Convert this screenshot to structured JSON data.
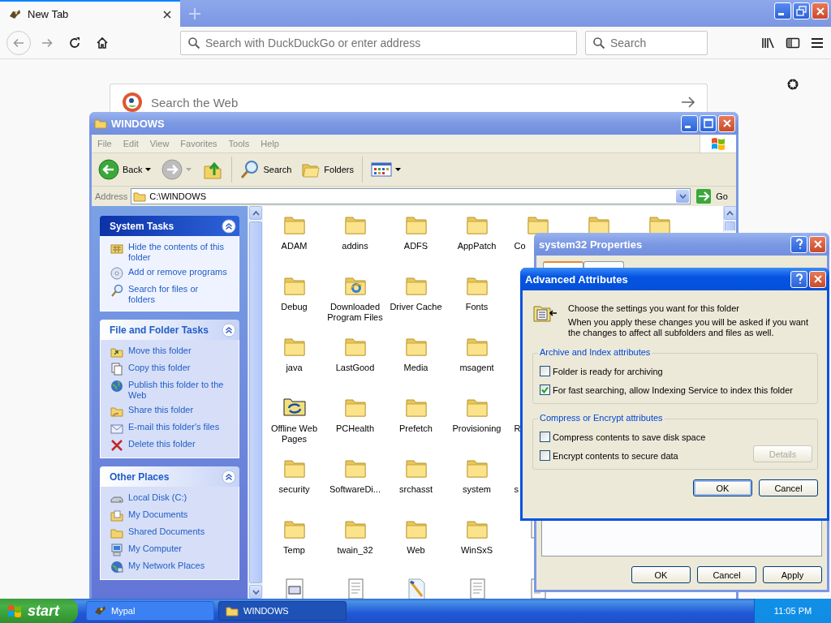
{
  "browser": {
    "tab": {
      "title": "New Tab"
    },
    "address_placeholder": "Search with DuckDuckGo or enter address",
    "search_placeholder": "Search",
    "page_search_placeholder": "Search the Web"
  },
  "explorer": {
    "title": "WINDOWS",
    "menu": [
      "File",
      "Edit",
      "View",
      "Favorites",
      "Tools",
      "Help"
    ],
    "toolbar": {
      "back": "Back",
      "search": "Search",
      "folders": "Folders"
    },
    "address_label": "Address",
    "address": "C:\\WINDOWS",
    "go": "Go",
    "panels": [
      {
        "title": "System Tasks",
        "kind": "primary",
        "items": [
          {
            "label": "Hide the contents of this folder",
            "kind": "hide"
          },
          {
            "label": "Add or remove programs",
            "kind": "programs"
          },
          {
            "label": "Search for files or folders",
            "kind": "search"
          }
        ]
      },
      {
        "title": "File and Folder Tasks",
        "kind": "normal",
        "items": [
          {
            "label": "Move this folder",
            "kind": "move"
          },
          {
            "label": "Copy this folder",
            "kind": "copy"
          },
          {
            "label": "Publish this folder to the Web",
            "kind": "publish"
          },
          {
            "label": "Share this folder",
            "kind": "share"
          },
          {
            "label": "E-mail this folder's files",
            "kind": "email"
          },
          {
            "label": "Delete this folder",
            "kind": "delete"
          }
        ]
      },
      {
        "title": "Other Places",
        "kind": "normal",
        "items": [
          {
            "label": "Local Disk (C:)",
            "kind": "disk"
          },
          {
            "label": "My Documents",
            "kind": "documents"
          },
          {
            "label": "Shared Documents",
            "kind": "shared"
          },
          {
            "label": "My Computer",
            "kind": "computer"
          },
          {
            "label": "My Network Places",
            "kind": "network"
          }
        ]
      }
    ],
    "file_rows": [
      [
        {
          "label": "ADAM",
          "kind": "folder"
        },
        {
          "label": "addins",
          "kind": "folder"
        },
        {
          "label": "ADFS",
          "kind": "folder"
        },
        {
          "label": "AppPatch",
          "kind": "folder"
        },
        {
          "label": "Co",
          "kind": "folder"
        },
        {
          "kind": "folder"
        },
        {
          "kind": "folder"
        }
      ],
      [
        {
          "label": "Debug",
          "kind": "folder"
        },
        {
          "label": "Downloaded Program Files",
          "kind": "web"
        },
        {
          "label": "Driver Cache",
          "kind": "folder"
        },
        {
          "label": "Fonts",
          "kind": "folder"
        }
      ],
      [
        {
          "label": "java",
          "kind": "folder"
        },
        {
          "label": "LastGood",
          "kind": "folder"
        },
        {
          "label": "Media",
          "kind": "folder"
        },
        {
          "label": "msagent",
          "kind": "folder"
        }
      ],
      [
        {
          "label": "Offline Web Pages",
          "kind": "sync"
        },
        {
          "label": "PCHealth",
          "kind": "folder"
        },
        {
          "label": "Prefetch",
          "kind": "folder"
        },
        {
          "label": "Provisioning",
          "kind": "folder"
        },
        {
          "label": "R",
          "kind": "cut"
        }
      ],
      [
        {
          "label": "security",
          "kind": "folder"
        },
        {
          "label": "SoftwareDi...",
          "kind": "folder"
        },
        {
          "label": "srchasst",
          "kind": "folder"
        },
        {
          "label": "system",
          "kind": "folder"
        },
        {
          "label": "s",
          "kind": "cut"
        }
      ],
      [
        {
          "label": "Temp",
          "kind": "folder"
        },
        {
          "label": "twain_32",
          "kind": "folder"
        },
        {
          "label": "Web",
          "kind": "folder"
        },
        {
          "label": "WinSxS",
          "kind": "folder"
        },
        {
          "kind": "text"
        }
      ],
      [
        {
          "kind": "window"
        },
        {
          "kind": "text"
        },
        {
          "kind": "paint"
        },
        {
          "kind": "text"
        },
        {
          "kind": "text"
        }
      ]
    ]
  },
  "properties": {
    "title": "system32 Properties",
    "buttons": [
      "OK",
      "Cancel",
      "Apply"
    ]
  },
  "advanced": {
    "title": "Advanced Attributes",
    "heading": "Choose the settings you want for this folder",
    "note": "When you apply these changes you will be asked if you want the changes to affect all subfolders and files as well.",
    "groups": [
      {
        "title": "Archive and Index attributes",
        "options": [
          {
            "label": "Folder is ready for archiving",
            "checked": false
          },
          {
            "label": "For fast searching, allow Indexing Service to index this folder",
            "checked": true
          }
        ]
      },
      {
        "title": "Compress or Encrypt attributes",
        "options": [
          {
            "label": "Compress contents to save disk space",
            "checked": false
          },
          {
            "label": "Encrypt contents to secure data",
            "checked": false
          }
        ]
      }
    ],
    "details": {
      "label": "Details",
      "disabled": true
    },
    "buttons": [
      "OK",
      "Cancel"
    ]
  },
  "taskbar": {
    "start": "start",
    "tasks": [
      {
        "label": "Mypal",
        "selected": false
      },
      {
        "label": "WINDOWS",
        "selected": true
      }
    ],
    "clock": "11:05 PM"
  }
}
